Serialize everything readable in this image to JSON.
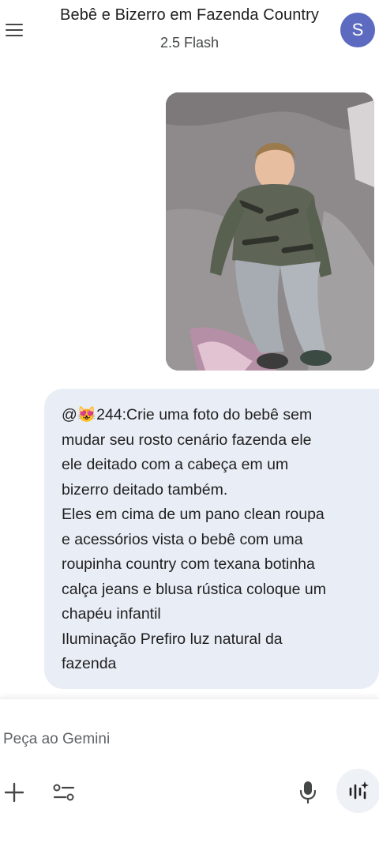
{
  "header": {
    "title": "Bebê e Bizerro em Fazenda Country",
    "model": "2.5 Flash",
    "avatar_letter": "S"
  },
  "message": {
    "text": "@😻244:Crie uma foto do bebê sem\nmudar seu rosto cenário fazenda ele\nele deitado com a cabeça em um\nbizerro deitado também.\nEles em cima de um pano clean roupa\ne acessórios vista o bebê com uma\nroupinha country com texana botinha\ncalça jeans e blusa rústica coloque um\nchapéu infantil\nIluminação Prefiro luz natural da\nfazenda"
  },
  "input": {
    "placeholder": "Peça ao Gemini"
  },
  "colors": {
    "avatar": "#5c6bc0",
    "bubble": "#e9eef6",
    "icon": "#444746"
  },
  "icons": [
    "menu-icon",
    "plus-icon",
    "tools-icon",
    "microphone-icon",
    "live-icon"
  ]
}
